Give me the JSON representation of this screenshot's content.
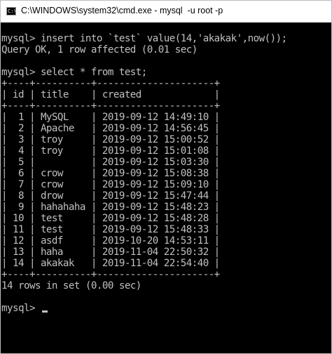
{
  "window": {
    "title": "C:\\WINDOWS\\system32\\cmd.exe - mysql  -u root -p",
    "icon_name": "cmd-icon",
    "icon_glyph": "C:\\"
  },
  "console": {
    "lines": [
      "mysql> insert into `test` value(14,'akakak',now());",
      "Query OK, 1 row affected (0.01 sec)",
      "",
      "mysql> select * from test;",
      "+----+----------+---------------------+",
      "| id | title    | created             |",
      "+----+----------+---------------------+",
      "|  1 | MySQL    | 2019-09-12 14:49:10 |",
      "|  2 | Apache   | 2019-09-12 14:56:45 |",
      "|  3 | troy     | 2019-09-12 15:00:52 |",
      "|  4 | troy     | 2019-09-12 15:01:08 |",
      "|  5 |          | 2019-09-12 15:03:30 |",
      "|  6 | crow     | 2019-09-12 15:08:38 |",
      "|  7 | crow     | 2019-09-12 15:09:10 |",
      "|  8 | drow     | 2019-09-12 15:47:44 |",
      "|  9 | hahahaha | 2019-09-12 15:48:23 |",
      "| 10 | test     | 2019-09-12 15:48:28 |",
      "| 11 | test     | 2019-09-12 15:48:33 |",
      "| 12 | asdf     | 2019-10-20 14:53:11 |",
      "| 13 | haha     | 2019-11-04 22:50:32 |",
      "| 14 | akakak   | 2019-11-04 22:54:40 |",
      "+----+----------+---------------------+",
      "14 rows in set (0.00 sec)",
      "",
      "mysql> "
    ]
  }
}
